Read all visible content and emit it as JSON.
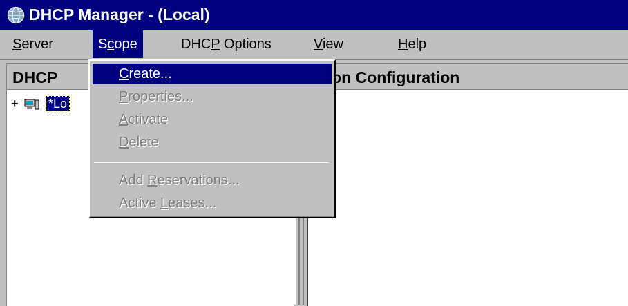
{
  "window": {
    "title": "DHCP Manager - (Local)",
    "icon": "network-globe-icon"
  },
  "menubar": {
    "items": [
      {
        "pre": "",
        "u": "S",
        "post": "erver"
      },
      {
        "pre": "S",
        "u": "c",
        "post": "ope"
      },
      {
        "pre": "DHC",
        "u": "P",
        "post": " Options"
      },
      {
        "pre": "",
        "u": "V",
        "post": "iew"
      },
      {
        "pre": "",
        "u": "H",
        "post": "elp"
      }
    ],
    "active_index": 1
  },
  "left_pane": {
    "header": "DHCP",
    "tree": {
      "expander": "+",
      "icon": "server-computer-icon",
      "label": "*Lo"
    }
  },
  "right_pane": {
    "header": "ption Configuration"
  },
  "scope_menu": {
    "items": [
      {
        "pre": "",
        "u": "C",
        "post": "reate...",
        "state": "selected"
      },
      {
        "pre": "",
        "u": "P",
        "post": "roperties...",
        "state": "disabled"
      },
      {
        "pre": "",
        "u": "A",
        "post": "ctivate",
        "state": "disabled"
      },
      {
        "pre": "",
        "u": "D",
        "post": "elete",
        "state": "disabled"
      },
      {
        "pre": "Add ",
        "u": "R",
        "post": "eservations...",
        "state": "disabled"
      },
      {
        "pre": "Active ",
        "u": "L",
        "post": "eases...",
        "state": "disabled"
      }
    ]
  },
  "colors": {
    "titlebar": "#000080",
    "face": "#c0c0c0",
    "highlight": "#000080",
    "disabled_text": "#808080"
  }
}
